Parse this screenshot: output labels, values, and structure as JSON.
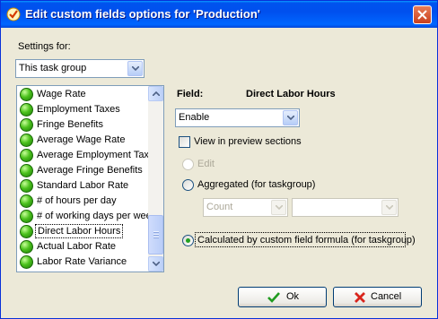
{
  "window": {
    "title": "Edit custom fields options for  'Production'",
    "icons": {
      "app": "check-shield-icon",
      "close": "close-icon"
    },
    "colors": {
      "titlebar": "#0054e3",
      "close": "#e0512c"
    }
  },
  "settings": {
    "label": "Settings for:",
    "selected": "This task group"
  },
  "fields_list": {
    "items": [
      {
        "label": "Wage Rate",
        "icon": "green-dot-icon"
      },
      {
        "label": "Employment Taxes",
        "icon": "green-dot-icon"
      },
      {
        "label": "Fringe Benefits",
        "icon": "green-dot-icon"
      },
      {
        "label": "Average Wage Rate",
        "icon": "green-dot-icon"
      },
      {
        "label": "Average Employment Taxe",
        "icon": "green-dot-icon"
      },
      {
        "label": "Average Fringe Benefits",
        "icon": "green-dot-icon"
      },
      {
        "label": "Standard Labor Rate",
        "icon": "green-dot-icon"
      },
      {
        "label": "# of hours per day",
        "icon": "green-dot-icon"
      },
      {
        "label": "# of working days per wee",
        "icon": "green-dot-icon"
      },
      {
        "label": "Direct Labor Hours",
        "icon": "green-dot-icon",
        "selected": true
      },
      {
        "label": "Actual Labor Rate",
        "icon": "green-dot-icon"
      },
      {
        "label": "Labor Rate Variance",
        "icon": "green-dot-icon"
      }
    ]
  },
  "field_panel": {
    "field_label": "Field:",
    "field_name": "Direct Labor Hours",
    "state_selected": "Enable",
    "view_in_preview": {
      "label": "View in preview sections",
      "checked": false
    },
    "options": {
      "edit": {
        "label": "Edit",
        "enabled": false,
        "checked": false
      },
      "aggregated": {
        "label": "Aggregated (for taskgroup)",
        "enabled": true,
        "checked": false
      },
      "aggregate_function": {
        "selected": "Count",
        "enabled": false
      },
      "aggregate_field": {
        "selected": "",
        "enabled": false
      },
      "calculated": {
        "label": "Calculated by custom field formula (for taskgroup)",
        "enabled": true,
        "checked": true
      }
    }
  },
  "buttons": {
    "ok": {
      "label": "Ok",
      "icon": "checkmark-icon"
    },
    "cancel": {
      "label": "Cancel",
      "icon": "red-x-icon"
    }
  }
}
